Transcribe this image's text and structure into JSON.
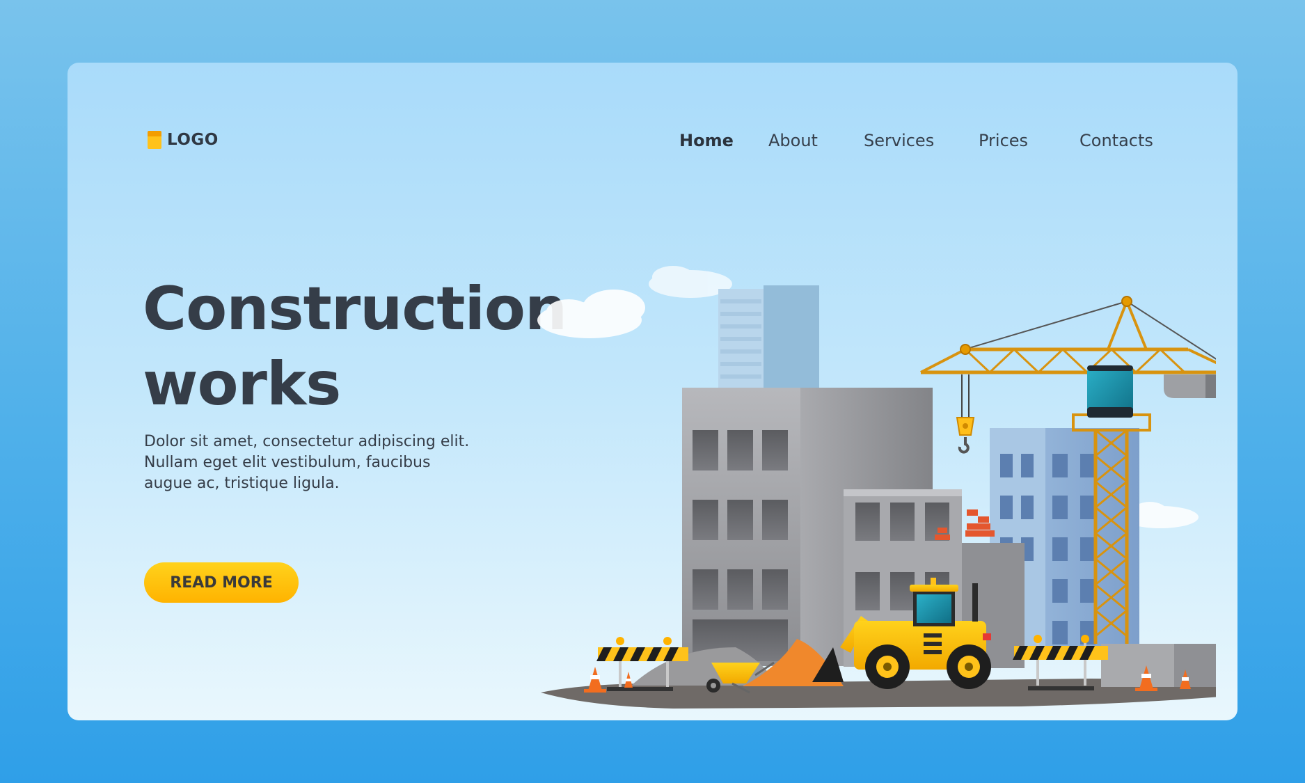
{
  "brand": {
    "logo_text": "LOGO"
  },
  "nav": {
    "items": [
      {
        "label": "Home",
        "active": true
      },
      {
        "label": "About",
        "active": false
      },
      {
        "label": "Services",
        "active": false
      },
      {
        "label": "Prices",
        "active": false
      },
      {
        "label": "Contacts",
        "active": false
      }
    ]
  },
  "hero": {
    "title_line1": "Construction",
    "title_line2": "works",
    "body": "Dolor sit amet, consectetur adipiscing elit. Nullam eget elit vestibulum, faucibus augue ac, tristique ligula.",
    "cta_label": "READ MORE"
  },
  "colors": {
    "background": "#4fb0ea",
    "card": "#b8e2fb",
    "text_dark": "#353d48",
    "accent_yellow": "#ffc21a",
    "crane_orange": "#d8930f",
    "building_gray": "#9c9da1"
  }
}
